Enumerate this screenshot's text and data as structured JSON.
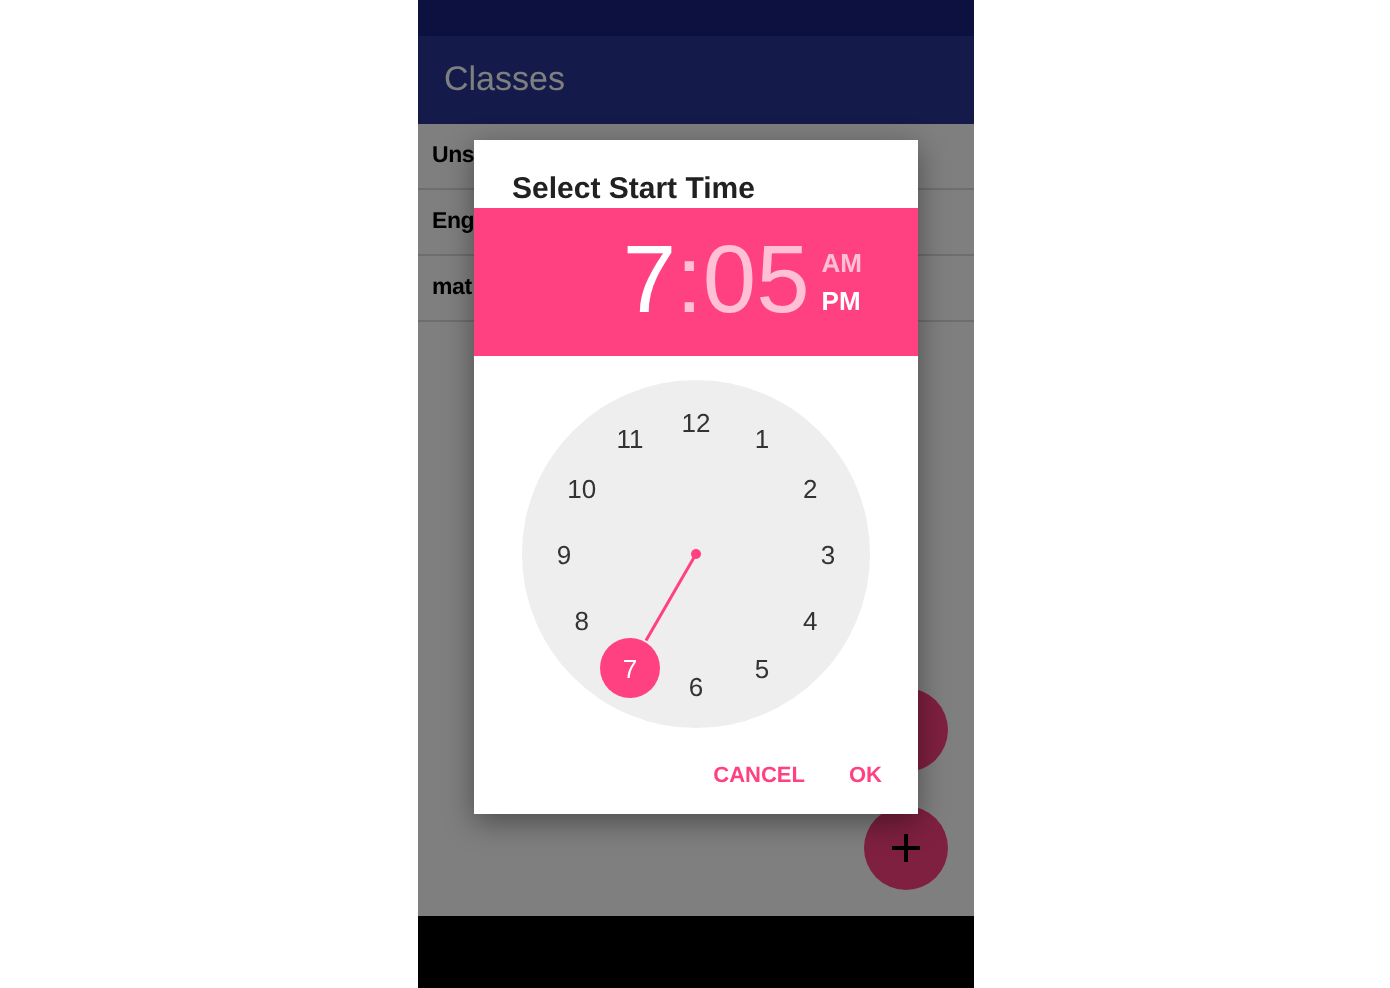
{
  "app_bar": {
    "title": "Classes"
  },
  "list": [
    {
      "label": "Uns"
    },
    {
      "label": "Eng"
    },
    {
      "label": "mat"
    }
  ],
  "fabs": [
    {
      "kind": "plain"
    },
    {
      "kind": "add"
    }
  ],
  "dialog": {
    "title": "Select Start Time",
    "time": {
      "hour": {
        "text": "7",
        "selected": true
      },
      "separator": ":",
      "minute": {
        "text": "05",
        "selected": false
      }
    },
    "periods": [
      {
        "label": "AM",
        "selected": false
      },
      {
        "label": "PM",
        "selected": true
      }
    ],
    "hours": [
      {
        "label": "12",
        "selected": false
      },
      {
        "label": "1",
        "selected": false
      },
      {
        "label": "2",
        "selected": false
      },
      {
        "label": "3",
        "selected": false
      },
      {
        "label": "4",
        "selected": false
      },
      {
        "label": "5",
        "selected": false
      },
      {
        "label": "6",
        "selected": false
      },
      {
        "label": "7",
        "selected": true
      },
      {
        "label": "8",
        "selected": false
      },
      {
        "label": "9",
        "selected": false
      },
      {
        "label": "10",
        "selected": false
      },
      {
        "label": "11",
        "selected": false
      }
    ],
    "buttons": [
      {
        "label": "CANCEL"
      },
      {
        "label": "OK"
      }
    ]
  }
}
